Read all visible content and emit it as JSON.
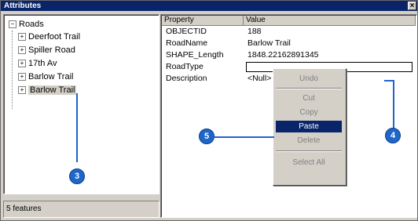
{
  "window": {
    "title": "Attributes",
    "close_glyph": "×"
  },
  "tree": {
    "root_expander": "−",
    "root_label": "Roads",
    "items": [
      {
        "label": "Deerfoot Trail",
        "expander": "+"
      },
      {
        "label": "Spiller Road",
        "expander": "+"
      },
      {
        "label": "17th Av",
        "expander": "+"
      },
      {
        "label": "Barlow Trail",
        "expander": "+"
      },
      {
        "label": "Barlow Trail",
        "expander": "+",
        "selected": true
      }
    ]
  },
  "status": {
    "text": "5 features"
  },
  "grid": {
    "headers": [
      "Property",
      "Value"
    ],
    "rows": [
      {
        "property": "OBJECTID",
        "value": "188"
      },
      {
        "property": "RoadName",
        "value": "Barlow Trail"
      },
      {
        "property": "SHAPE_Length",
        "value": "1848.22162891345"
      },
      {
        "property": "RoadType",
        "value": ""
      },
      {
        "property": "Description",
        "value": "<Null>"
      }
    ]
  },
  "context_menu": {
    "items": [
      {
        "label": "Undo",
        "enabled": false
      },
      {
        "label": "Cut",
        "enabled": false
      },
      {
        "label": "Copy",
        "enabled": false
      },
      {
        "label": "Paste",
        "enabled": true,
        "highlighted": true
      },
      {
        "label": "Delete",
        "enabled": false
      },
      {
        "label": "Select All",
        "enabled": false
      }
    ]
  },
  "callouts": [
    "3",
    "4",
    "5"
  ],
  "colors": {
    "accent": "#1f66c9",
    "title_bar": "#0a246a",
    "highlight": "#0a246a"
  }
}
